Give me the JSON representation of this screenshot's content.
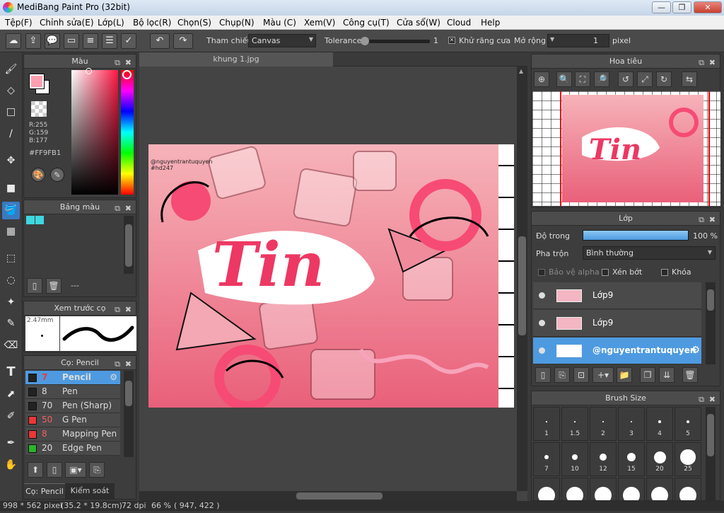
{
  "window": {
    "title": "MediBang Paint Pro (32bit)",
    "btn_min": "—",
    "btn_max": "❐",
    "btn_close": "✕"
  },
  "menu": [
    "Tệp(F)",
    "Chỉnh sửa(E)",
    "Lớp(L)",
    "Bộ lọc(R)",
    "Chọn(S)",
    "Chụp(N)",
    "Màu (C)",
    "Xem(V)",
    "Công cụ(T)",
    "Cửa sổ(W)",
    "Cloud",
    "Help"
  ],
  "toolbar": {
    "reference_label": "Tham chiếu",
    "reference_value": "Canvas",
    "tolerance_label": "Tolerance",
    "tolerance_value": "1",
    "tolerance_fraction": 0.0,
    "antialias_label": "Khử răng cưa",
    "antialias_checked": true,
    "expand_label": "Mở rộng",
    "expand_value": "1",
    "expand_unit": "pixel"
  },
  "color_panel": {
    "title": "Màu",
    "r": "R:255",
    "g": "G:159",
    "b": "B:177",
    "hex": "#FF9FB1",
    "primary_color": "#FF9FB1"
  },
  "palette_panel": {
    "title": "Bảng màu",
    "swatches": [
      "#3dd8e0",
      "#3dd8e0"
    ],
    "name": "---"
  },
  "brush_preview": {
    "title": "Xem trước cọ",
    "size": "2.47mm"
  },
  "brush_panel": {
    "title": "Cọ: Pencil",
    "items": [
      {
        "size": "7",
        "name": "Pencil",
        "color": "#222222",
        "selected": true
      },
      {
        "size": "8",
        "name": "Pen",
        "color": "#222222"
      },
      {
        "size": "70",
        "name": "Pen (Sharp)",
        "color": "#222222"
      },
      {
        "size": "50",
        "name": "G Pen",
        "color": "#e83838"
      },
      {
        "size": "8",
        "name": "Mapping Pen",
        "color": "#e83838"
      },
      {
        "size": "20",
        "name": "Edge Pen",
        "color": "#2bb52b"
      }
    ],
    "tab1": "Cọ: Pencil",
    "tab2": "Kiểm soát cọ"
  },
  "canvas": {
    "tab": "khung 1.jpg",
    "watermark": "@nguyentrantuquyen",
    "watermark2": "#hd247",
    "logo": "Tin"
  },
  "navigator": {
    "title": "Hoa tiêu",
    "logo": "Tin"
  },
  "layer_panel": {
    "title": "Lớp",
    "opacity_label": "Độ trong",
    "opacity_value": "100 %",
    "opacity_fraction": 1.0,
    "blend_label": "Pha trộn",
    "blend_value": "Bình thường",
    "protect_alpha": "Bảo vệ alpha",
    "clipping": "Xén bớt",
    "lock": "Khóa",
    "layers": [
      {
        "name": "Lớp9"
      },
      {
        "name": "Lớp9"
      },
      {
        "name": "@nguyentrantuquyen",
        "selected": true
      }
    ]
  },
  "brush_size": {
    "title": "Brush Size",
    "sizes": [
      "1",
      "1.5",
      "2",
      "3",
      "4",
      "5",
      "7",
      "10",
      "12",
      "15",
      "20",
      "25"
    ]
  },
  "status": {
    "size": "998 * 562 pixel",
    "cm": "(35.2 * 19.8cm)",
    "dpi": "72 dpi",
    "zoom": "66 %",
    "coords": "( 947, 422 )"
  }
}
